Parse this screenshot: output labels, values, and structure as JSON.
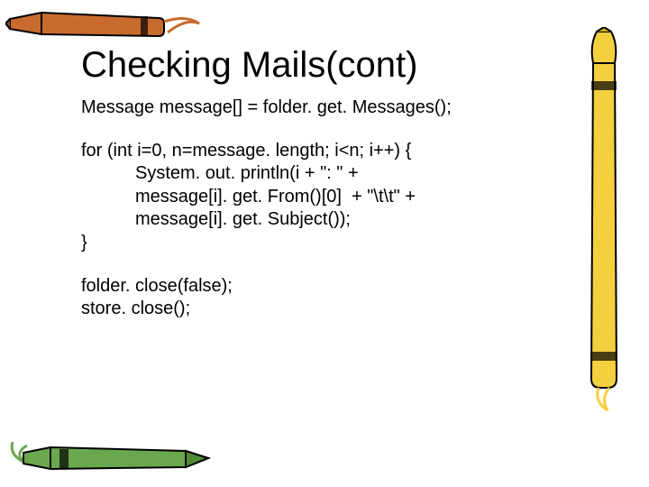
{
  "title": "Checking Mails(cont)",
  "code": {
    "l1": "Message message[] = folder. get. Messages();",
    "l2": "for (int i=0, n=message. length; i<n; i++) {",
    "l3": "System. out. println(i + \": \" +",
    "l4": "message[i]. get. From()[0]  + \"\\t\\t\" +",
    "l5": "message[i]. get. Subject());",
    "l6": "}",
    "l7": "folder. close(false);",
    "l8": "store. close();"
  }
}
